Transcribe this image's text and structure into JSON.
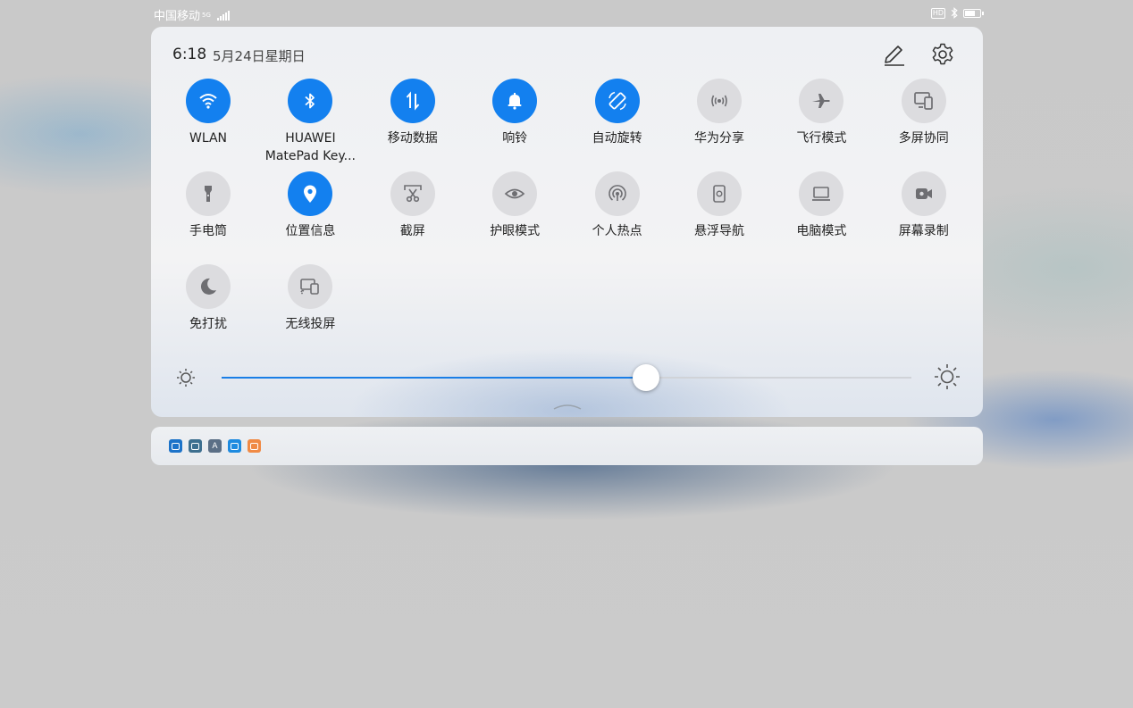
{
  "status_bar": {
    "carrier": "中国移动",
    "network": "5G",
    "hd_label": "HD",
    "icons": [
      "signal-icon",
      "hd-icon",
      "bluetooth-icon",
      "battery-icon"
    ]
  },
  "panel": {
    "time": "6:18",
    "date": "5月24日星期日",
    "edit_icon": "pencil-icon",
    "settings_icon": "gear-icon"
  },
  "tiles": [
    {
      "label": "WLAN",
      "icon": "wifi-icon",
      "active": true
    },
    {
      "label": "HUAWEI MatePad Key...",
      "icon": "bluetooth-icon",
      "active": true
    },
    {
      "label": "移动数据",
      "icon": "mobile-data-icon",
      "active": true
    },
    {
      "label": "响铃",
      "icon": "bell-icon",
      "active": true
    },
    {
      "label": "自动旋转",
      "icon": "auto-rotate-icon",
      "active": true
    },
    {
      "label": "华为分享",
      "icon": "huawei-share-icon",
      "active": false
    },
    {
      "label": "飞行模式",
      "icon": "airplane-icon",
      "active": false
    },
    {
      "label": "多屏协同",
      "icon": "multi-screen-icon",
      "active": false
    },
    {
      "label": "手电筒",
      "icon": "flashlight-icon",
      "active": false
    },
    {
      "label": "位置信息",
      "icon": "location-pin-icon",
      "active": true
    },
    {
      "label": "截屏",
      "icon": "screenshot-scissors-icon",
      "active": false
    },
    {
      "label": "护眼模式",
      "icon": "eye-icon",
      "active": false
    },
    {
      "label": "个人热点",
      "icon": "hotspot-icon",
      "active": false
    },
    {
      "label": "悬浮导航",
      "icon": "floating-nav-icon",
      "active": false
    },
    {
      "label": "电脑模式",
      "icon": "laptop-icon",
      "active": false
    },
    {
      "label": "屏幕录制",
      "icon": "screen-record-icon",
      "active": false
    },
    {
      "label": "免打扰",
      "icon": "moon-icon",
      "active": false
    },
    {
      "label": "无线投屏",
      "icon": "wireless-projection-icon",
      "active": false
    }
  ],
  "brightness": {
    "level": 0.615,
    "low_icon": "sun-small-icon",
    "high_icon": "sun-large-icon",
    "accent": "#1a7ee6"
  },
  "notification_bar": {
    "apps": [
      {
        "icon": "app-store-icon",
        "color": "#1c73c9"
      },
      {
        "icon": "gallery-icon",
        "color": "#3d6f8f"
      },
      {
        "icon": "font-icon",
        "color": "#5b6f86",
        "glyph": "A"
      },
      {
        "icon": "customer-service-icon",
        "color": "#1e8be0"
      },
      {
        "icon": "message-icon",
        "color": "#f08a45"
      }
    ]
  },
  "colors": {
    "active_tile": "#1380ef",
    "inactive_tile": "#dcdcdf"
  }
}
